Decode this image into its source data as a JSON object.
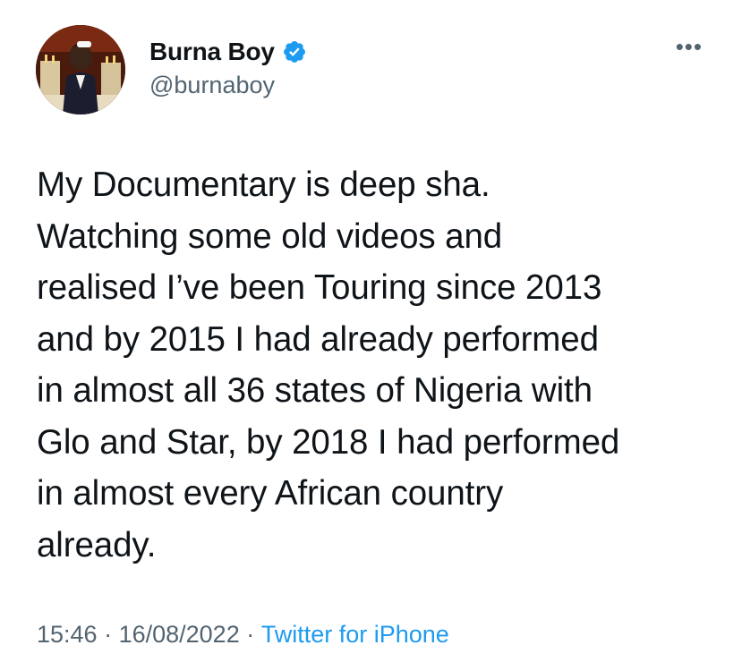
{
  "author": {
    "display_name": "Burna Boy",
    "handle": "@burnaboy",
    "verified": true,
    "verified_icon": "verified-badge-icon",
    "avatar_icon": "profile-photo"
  },
  "more_icon": "more-options-icon",
  "tweet": {
    "text": "My Documentary is deep sha.\nWatching some old videos and\nrealised I’ve been Touring since 2013\nand by 2015 I had already performed\nin almost all 36 states of Nigeria with\nGlo and Star, by 2018 I had performed\nin almost every African country\nalready.",
    "time": "15:46",
    "date": "16/08/2022",
    "separator": " · ",
    "source": "Twitter for iPhone"
  },
  "colors": {
    "text": "#0f1419",
    "secondary": "#536471",
    "accent": "#1d9bf0"
  }
}
